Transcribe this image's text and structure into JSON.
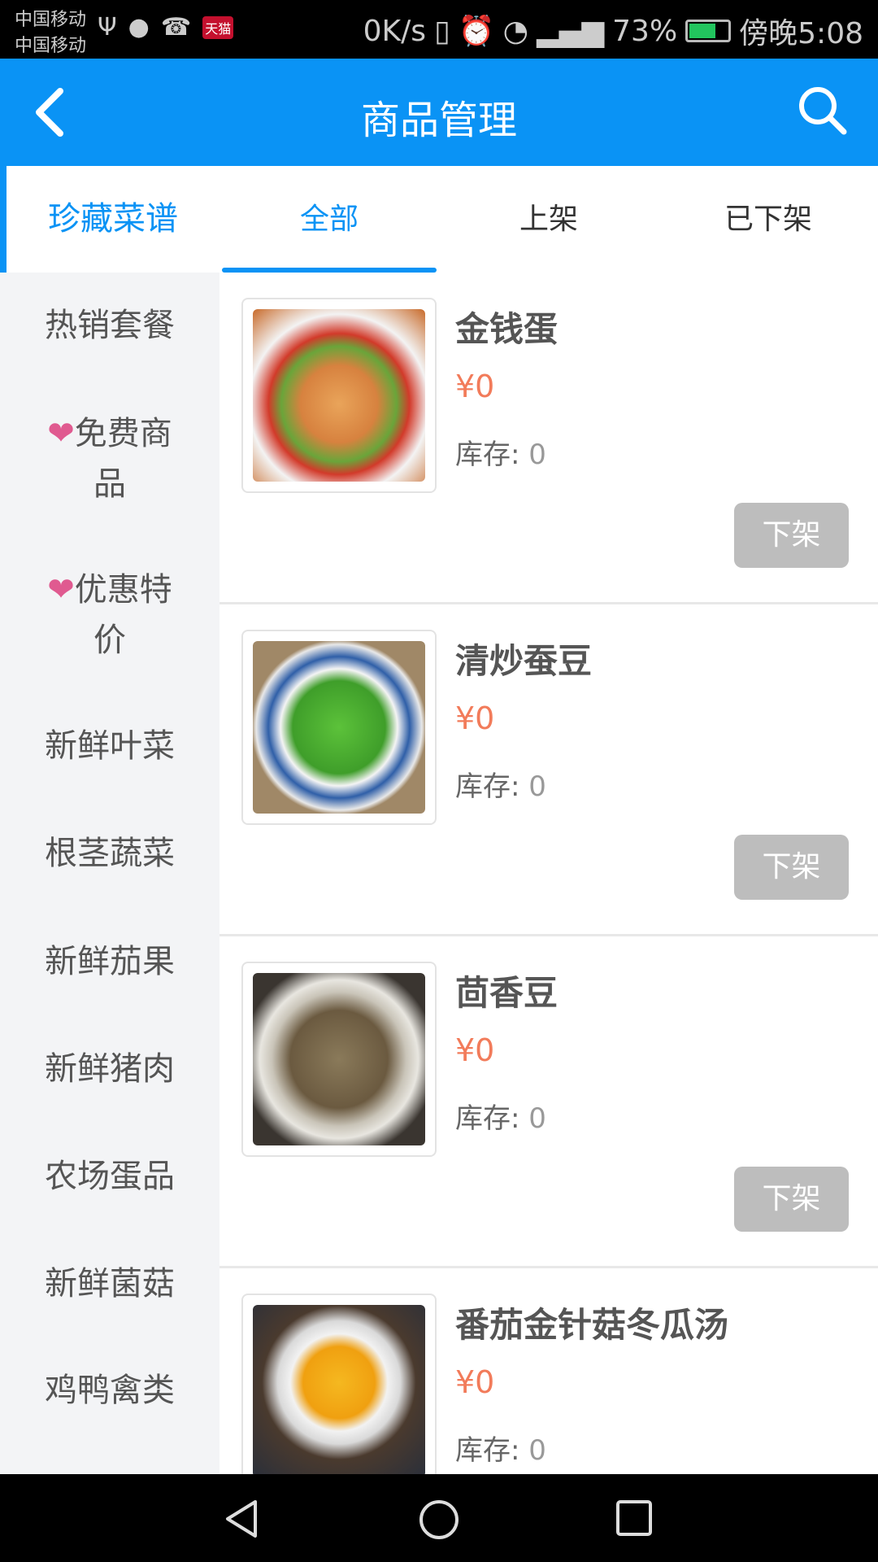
{
  "status_bar": {
    "carrier1": "中国移动",
    "carrier2": "中国移动",
    "tmall": "天猫",
    "speed": "0K/s",
    "battery": "73%",
    "time": "傍晚5:08"
  },
  "header": {
    "title": "商品管理",
    "back_icon": "back-arrow-icon",
    "search_icon": "search-icon"
  },
  "colors": {
    "primary": "#0a93f5",
    "price": "#f27b5a",
    "button": "#bdbdbd",
    "heart": "#e05a90"
  },
  "sidebar": {
    "items": [
      {
        "label": "珍藏菜谱",
        "active": true
      },
      {
        "label": "热销套餐"
      },
      {
        "label": "免费商品",
        "icon": "heart-icon"
      },
      {
        "label": "优惠特价",
        "icon": "heart-icon"
      },
      {
        "label": "新鲜叶菜"
      },
      {
        "label": "根茎蔬菜"
      },
      {
        "label": "新鲜茄果"
      },
      {
        "label": "新鲜猪肉"
      },
      {
        "label": "农场蛋品"
      },
      {
        "label": "新鲜菌菇"
      },
      {
        "label": "鸡鸭禽类"
      }
    ]
  },
  "tabs": [
    {
      "label": "全部",
      "active": true
    },
    {
      "label": "上架"
    },
    {
      "label": "已下架"
    }
  ],
  "products": [
    {
      "name": "金钱蛋",
      "price": "¥0",
      "stock_label": "库存:",
      "stock": "0",
      "action": "下架"
    },
    {
      "name": "清炒蚕豆",
      "price": "¥0",
      "stock_label": "库存:",
      "stock": "0",
      "action": "下架"
    },
    {
      "name": "茴香豆",
      "price": "¥0",
      "stock_label": "库存:",
      "stock": "0",
      "action": "下架"
    },
    {
      "name": "番茄金针菇冬瓜汤",
      "price": "¥0",
      "stock_label": "库存:",
      "stock": "0"
    }
  ]
}
